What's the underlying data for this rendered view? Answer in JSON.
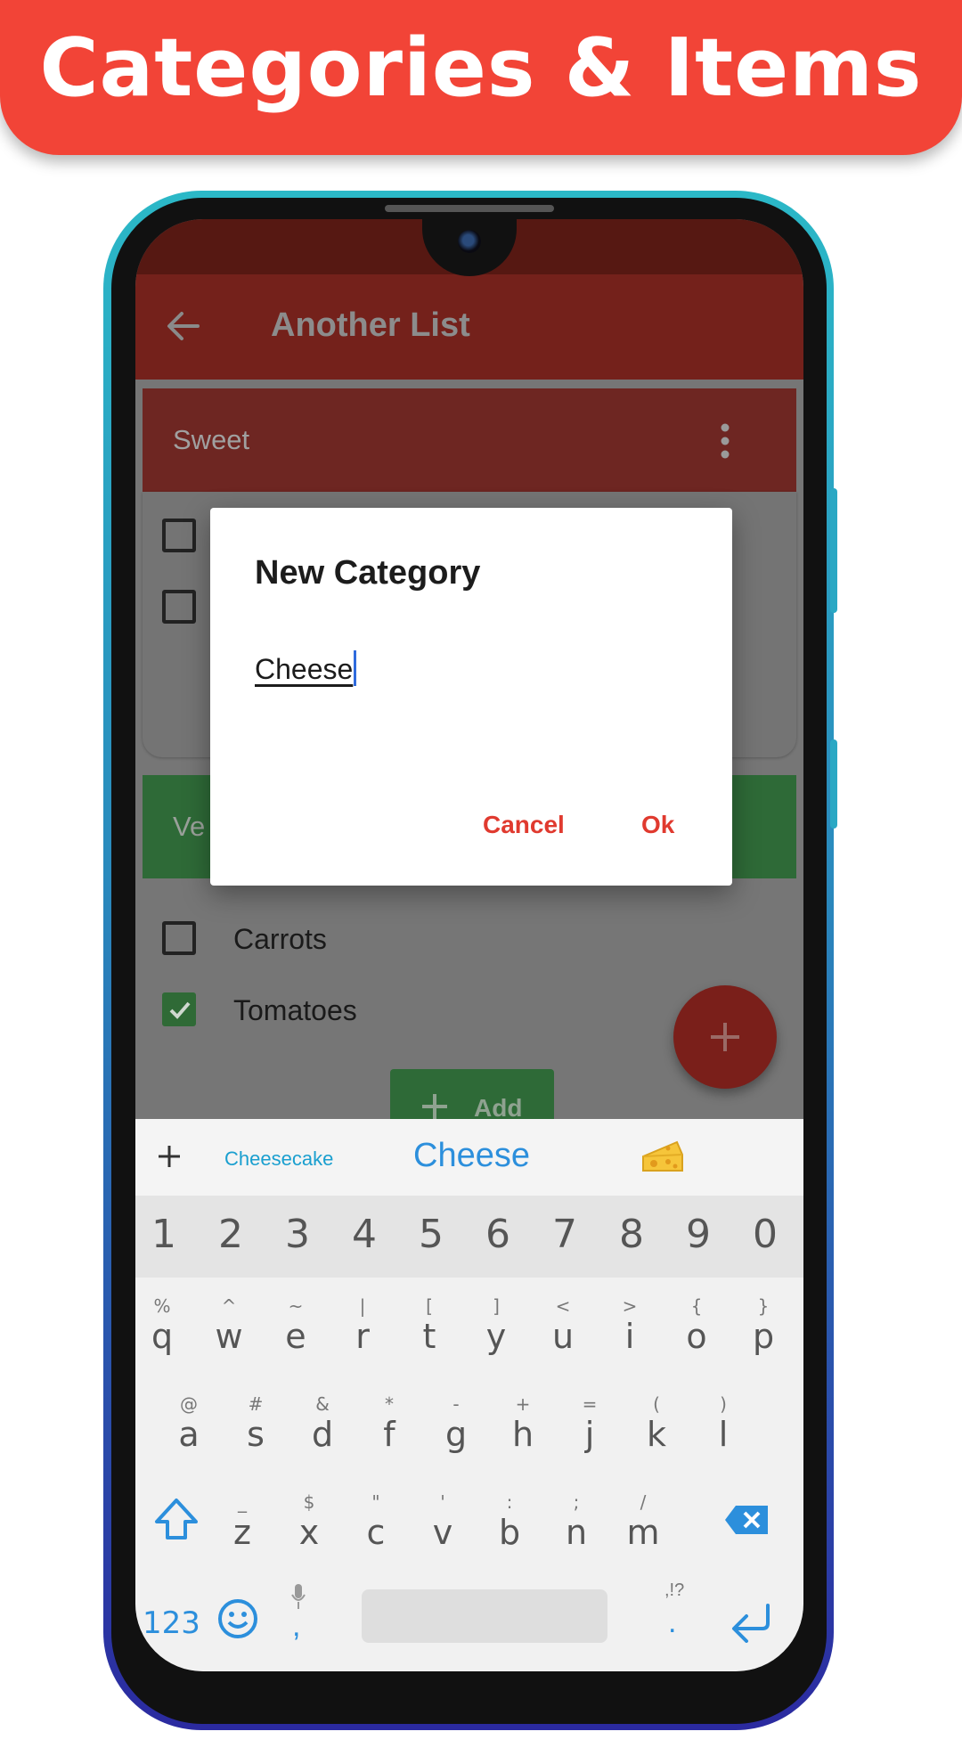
{
  "banner": {
    "title": "Categories & Items"
  },
  "app": {
    "title": "Another List",
    "categories": [
      {
        "name": "Sweet",
        "color": "#e53935",
        "items": [
          {
            "checked": false
          },
          {
            "checked": false
          }
        ]
      },
      {
        "name": "Ve",
        "color": "#43a047",
        "items": [
          {
            "label": "Carrots",
            "checked": false
          },
          {
            "label": "Tomatoes",
            "checked": true
          }
        ]
      }
    ],
    "add_button_label": "Add",
    "fab_color": "#e53935"
  },
  "dialog": {
    "title": "New Category",
    "input_value": "Cheese",
    "cancel_label": "Cancel",
    "ok_label": "Ok",
    "accent_color": "#e53935"
  },
  "keyboard": {
    "suggestions": {
      "left": "Cheesecake",
      "center": "Cheese",
      "emoji": "cheese-wedge-icon"
    },
    "number_row": [
      "1",
      "2",
      "3",
      "4",
      "5",
      "6",
      "7",
      "8",
      "9",
      "0"
    ],
    "row1": {
      "letters": [
        "q",
        "w",
        "e",
        "r",
        "t",
        "y",
        "u",
        "i",
        "o",
        "p"
      ],
      "symbols": [
        "%",
        "^",
        "~",
        "|",
        "[",
        "]",
        "<",
        ">",
        "{",
        "}"
      ]
    },
    "row2": {
      "letters": [
        "a",
        "s",
        "d",
        "f",
        "g",
        "h",
        "j",
        "k",
        "l"
      ],
      "symbols": [
        "@",
        "#",
        "&",
        "*",
        "-",
        "+",
        "=",
        "(",
        ")"
      ]
    },
    "row3": {
      "letters": [
        "z",
        "x",
        "c",
        "v",
        "b",
        "n",
        "m"
      ],
      "symbols": [
        "_",
        "$",
        "\"",
        "'",
        ":",
        ";",
        "/"
      ]
    },
    "bottom": {
      "numbers_toggle": "123",
      "comma": ",",
      "period": ".",
      "punct_hint": ",!?"
    }
  }
}
